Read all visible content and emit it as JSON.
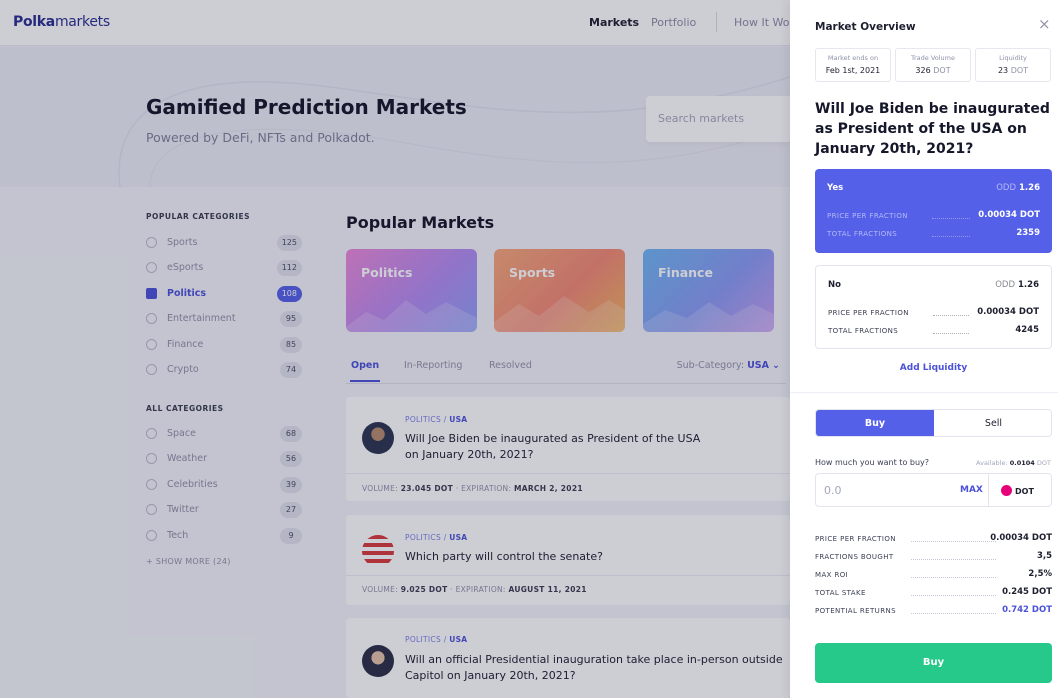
{
  "brand": {
    "logo_bold": "Polka",
    "logo_light": "markets"
  },
  "nav": {
    "markets": "Markets",
    "portfolio": "Portfolio",
    "how_it_works": "How It Wo"
  },
  "hero": {
    "title": "Gamified Prediction Markets",
    "subtitle": "Powered by DeFi, NFTs and Polkadot.",
    "search_placeholder": "Search markets"
  },
  "sidebar": {
    "popular_heading": "POPULAR CATEGORIES",
    "popular": [
      {
        "label": "Sports",
        "count": "125",
        "icon": "sports-icon"
      },
      {
        "label": "eSports",
        "count": "112",
        "icon": "esports-icon"
      },
      {
        "label": "Politics",
        "count": "108",
        "icon": "politics-icon",
        "active": true
      },
      {
        "label": "Entertainment",
        "count": "95",
        "icon": "entertainment-icon"
      },
      {
        "label": "Finance",
        "count": "85",
        "icon": "finance-icon"
      },
      {
        "label": "Crypto",
        "count": "74",
        "icon": "crypto-icon"
      }
    ],
    "all_heading": "ALL CATEGORIES",
    "all": [
      {
        "label": "Space",
        "count": "68",
        "icon": "space-icon"
      },
      {
        "label": "Weather",
        "count": "56",
        "icon": "weather-icon"
      },
      {
        "label": "Celebrities",
        "count": "39",
        "icon": "celebrities-icon"
      },
      {
        "label": "Twitter",
        "count": "27",
        "icon": "twitter-icon"
      },
      {
        "label": "Tech",
        "count": "9",
        "icon": "tech-icon"
      }
    ],
    "show_more": "SHOW MORE (24)"
  },
  "main": {
    "popular_title": "Popular Markets",
    "cards": [
      "Politics",
      "Sports",
      "Finance"
    ],
    "tabs": [
      "Open",
      "In-Reporting",
      "Resolved"
    ],
    "subcategory_label": "Sub-Category:",
    "subcategory_value": "USA",
    "markets": [
      {
        "category": "POLITICS",
        "sub": "USA",
        "question": "Will Joe Biden be inaugurated as President of the USA on January 20th, 2021?",
        "volume_label": "VOLUME:",
        "volume": "23.045 DOT",
        "exp_label": "EXPIRATION:",
        "expiration": "MARCH 2, 2021"
      },
      {
        "category": "POLITICS",
        "sub": "USA",
        "question": "Which party will control the senate?",
        "volume_label": "VOLUME:",
        "volume": "9.025 DOT",
        "exp_label": "EXPIRATION:",
        "expiration": "AUGUST 11, 2021"
      },
      {
        "category": "POLITICS",
        "sub": "USA",
        "question": "Will an official Presidential inauguration take place in-person outside Capitol on January 20th, 2021?"
      }
    ]
  },
  "panel": {
    "title": "Market Overview",
    "close": "×",
    "stats": [
      {
        "key": "Market ends on",
        "value": "Feb 1st, 2021",
        "unit": ""
      },
      {
        "key": "Trade Volume",
        "value": "326",
        "unit": "DOT"
      },
      {
        "key": "Liquidity",
        "value": "23",
        "unit": "DOT"
      }
    ],
    "question": "Will Joe Biden be inaugurated as President of the USA on January 20th, 2021?",
    "outcomes": [
      {
        "name": "Yes",
        "odd_label": "ODD",
        "odd": "1.26",
        "ppf_label": "PRICE PER FRACTION",
        "ppf": "0.00034 DOT",
        "tf_label": "TOTAL FRACTIONS",
        "tf": "2359"
      },
      {
        "name": "No",
        "odd_label": "ODD",
        "odd": "1.26",
        "ppf_label": "PRICE PER FRACTION",
        "ppf": "0.00034 DOT",
        "tf_label": "TOTAL FRACTIONS",
        "tf": "4245"
      }
    ],
    "add_liquidity": "Add Liquidity",
    "buy_tab": "Buy",
    "sell_tab": "Sell",
    "how_much": "How much you want to buy?",
    "available_label": "Available:",
    "available_value": "0.0104",
    "available_unit": "DOT",
    "amount_value": "0.0",
    "max": "MAX",
    "token": "DOT",
    "summary": [
      {
        "key": "PRICE PER FRACTION",
        "value": "0.00034 DOT"
      },
      {
        "key": "FRACTIONS BOUGHT",
        "value": "3,5"
      },
      {
        "key": "MAX ROI",
        "value": "2,5%"
      },
      {
        "key": "TOTAL STAKE",
        "value": "0.245 DOT"
      },
      {
        "key": "POTENTIAL RETURNS",
        "value": "0.742 DOT"
      }
    ],
    "buy_button": "Buy"
  },
  "colors": {
    "accent": "#5560e8",
    "success": "#26c98a",
    "polkadot": "#e6007a"
  }
}
